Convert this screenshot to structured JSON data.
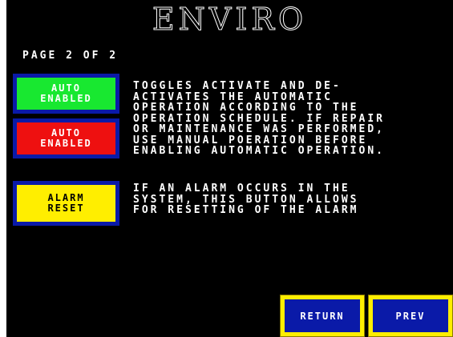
{
  "header": {
    "title": "ENVIRO",
    "page_indicator": "PAGE 2 OF 2"
  },
  "buttons": {
    "auto_enabled_green": "AUTO\nENABLED",
    "auto_enabled_red": "AUTO\nENABLED",
    "alarm_reset": "ALARM\nRESET"
  },
  "descriptions": {
    "auto": "TOGGLES ACTIVATE AND DE-\nACTIVATES THE AUTOMATIC\nOPERATION ACCORDING TO THE\nOPERATION SCHEDULE. IF REPAIR\nOR MAINTENANCE WAS PERFORMED,\nUSE MANUAL POERATION BEFORE\nENABLING AUTOMATIC OPERATION.",
    "alarm": "IF AN ALARM OCCURS IN THE\nSYSTEM, THIS BUTTON ALLOWS\nFOR RESETTING OF THE ALARM"
  },
  "nav": {
    "return_label": "RETURN",
    "prev_label": "PREV"
  },
  "colors": {
    "background": "#000000",
    "frame_blue": "#0a1aa8",
    "green": "#18e830",
    "red": "#ee1010",
    "yellow": "#ffee00"
  }
}
